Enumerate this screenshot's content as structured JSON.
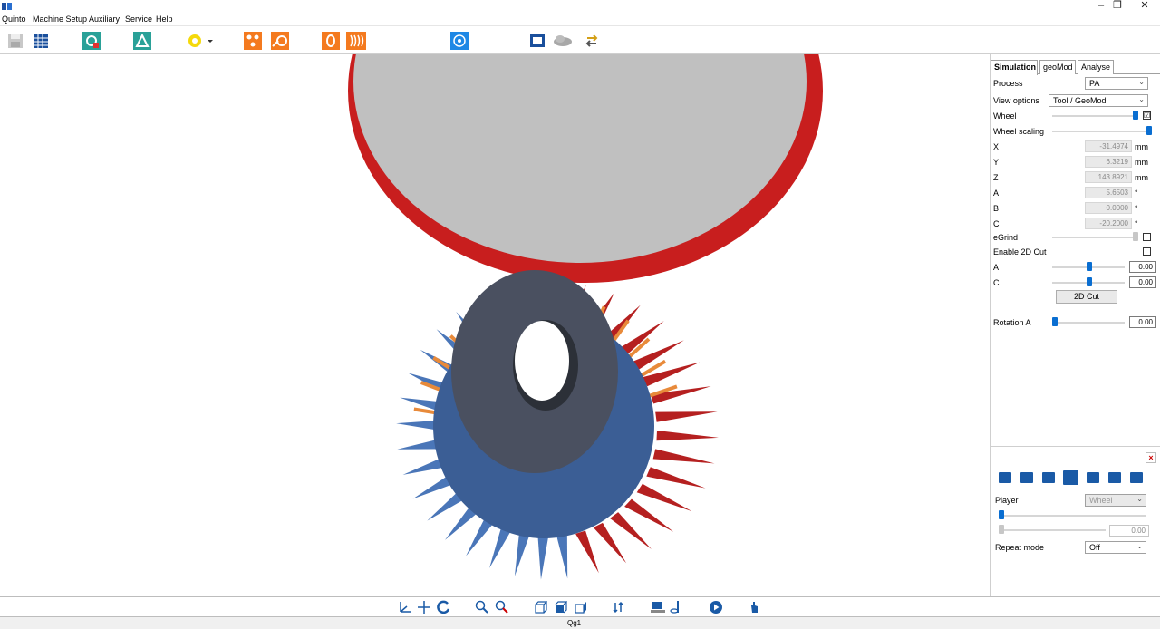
{
  "window": {
    "minimize_glyph": "–",
    "restore_glyph": "❐",
    "close_glyph": "✕"
  },
  "menu": [
    "Quinto",
    "Machine Setup",
    "Auxiliary",
    "Service",
    "Help"
  ],
  "toolbar": {
    "icons": [
      "save-icon",
      "table-icon",
      "gear-wheel-icon",
      "gear-machine-icon",
      "yellow-gear-icon",
      "dropdown-arrow-icon",
      "orange-multi-icon",
      "orange-tool-icon",
      "orange-disk-icon",
      "orange-wave-icon",
      "target-icon",
      "book-icon",
      "cloud-icon",
      "arrow-swap-icon"
    ],
    "colors": {
      "teal": "#2aa198",
      "orange": "#f47a1f",
      "blue": "#1e88e5",
      "yellow": "#f5d90a"
    }
  },
  "panel": {
    "tabs": [
      "Simulation",
      "geoMod",
      "Analyse"
    ],
    "active_tab": "Simulation",
    "process": {
      "label": "Process",
      "value": "PA"
    },
    "view_options": {
      "label": "View options",
      "value": "Tool / GeoMod"
    },
    "wheel": {
      "label": "Wheel",
      "checked": "☑"
    },
    "wheel_scaling": {
      "label": "Wheel scaling"
    },
    "coords": [
      {
        "label": "X",
        "value": "-31.4974",
        "unit": "mm"
      },
      {
        "label": "Y",
        "value": "6.3219",
        "unit": "mm"
      },
      {
        "label": "Z",
        "value": "143.8921",
        "unit": "mm"
      },
      {
        "label": "A",
        "value": "5.6503",
        "unit": "°"
      },
      {
        "label": "B",
        "value": "0.0000",
        "unit": "°"
      },
      {
        "label": "C",
        "value": "-20.2000",
        "unit": "°"
      }
    ],
    "egrind": {
      "label": "eGrind"
    },
    "enable_2d_cut": {
      "label": "Enable 2D Cut"
    },
    "cut_a": {
      "label": "A",
      "value": "0.00"
    },
    "cut_c": {
      "label": "C",
      "value": "0.00"
    },
    "cut_button": "2D Cut",
    "rotation_a": {
      "label": "Rotation A",
      "value": "0.00"
    }
  },
  "player": {
    "close": "×",
    "buttons": [
      "skip-start-icon",
      "rewind-icon",
      "step-back-icon",
      "play-icon",
      "step-forward-icon",
      "fast-forward-icon",
      "skip-end-icon"
    ],
    "player_label": "Player",
    "player_value": "Wheel",
    "progress_value": "0.00",
    "repeat_label": "Repeat mode",
    "repeat_value": "Off"
  },
  "bottom_toolbar": {
    "icons": [
      "axes-icon",
      "pan-icon",
      "rotate-icon",
      "zoom-icon",
      "zoom-fit-icon",
      "view-front-icon",
      "view-iso-icon",
      "view-side-icon",
      "swap-icon",
      "machine-icon",
      "tool-icon",
      "play-circle-icon",
      "hand-icon"
    ]
  },
  "status": {
    "text": "Qg1"
  },
  "scene": {
    "wheel_color": "#c0c0c0",
    "wheel_rim_color": "#c81e1e",
    "gear_red": "#b52020",
    "gear_blue": "#4a76b8",
    "gear_orange": "#e88a3a",
    "gear_hub": "#4a5060"
  }
}
